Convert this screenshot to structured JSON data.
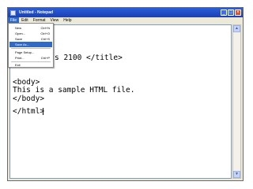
{
  "window": {
    "title": "Untitled - Notepad",
    "minimize_glyph": "_",
    "maximize_glyph": "□",
    "close_glyph": "×"
  },
  "menubar": {
    "items": [
      "File",
      "Edit",
      "Format",
      "View",
      "Help"
    ],
    "active": "File"
  },
  "file_menu": {
    "items": [
      {
        "label": "New",
        "shortcut": "Ctrl+N"
      },
      {
        "label": "Open...",
        "shortcut": "Ctrl+O"
      },
      {
        "label": "Save",
        "shortcut": "Ctrl+S"
      },
      {
        "label": "Save As...",
        "shortcut": "",
        "highlighted": true
      },
      {
        "label": "Page Setup...",
        "shortcut": ""
      },
      {
        "label": "Print...",
        "shortcut": "Ctrl+P"
      },
      {
        "label": "Exit",
        "shortcut": ""
      }
    ]
  },
  "editor": {
    "lines": [
      "s 2100 </title>",
      "<body>",
      "This is a sample HTML file.",
      "</body>",
      "</html>"
    ]
  },
  "scrollbar": {
    "up_glyph": "▲",
    "down_glyph": "▼"
  },
  "colors": {
    "titlebar": "#2a5fd9",
    "menu_highlight": "#316ac5",
    "window_face": "#ece9d8"
  }
}
